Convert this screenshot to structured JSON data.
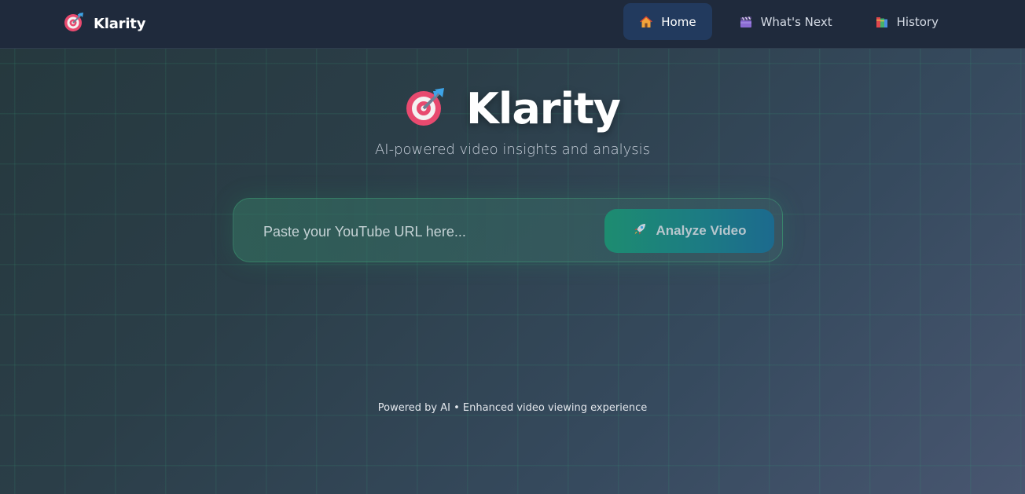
{
  "nav": {
    "brand": {
      "icon": "target-dart-icon",
      "name": "Klarity"
    },
    "links": [
      {
        "icon": "house-icon",
        "label": "Home",
        "active": true
      },
      {
        "icon": "clapperboard-icon",
        "label": "What's Next",
        "active": false
      },
      {
        "icon": "books-icon",
        "label": "History",
        "active": false
      }
    ]
  },
  "hero": {
    "icon": "target-dart-icon",
    "title": "Klarity",
    "subtitle": "AI-powered video insights and analysis"
  },
  "search": {
    "placeholder": "Paste your YouTube URL here...",
    "value": "",
    "button_icon": "rocket-icon",
    "button_label": "Analyze Video"
  },
  "footer": {
    "text": "Powered by AI • Enhanced video viewing experience"
  },
  "colors": {
    "nav_background": "#1f2a3c",
    "nav_active": "#223a5e",
    "accent_green": "#1d8c70",
    "accent_blue": "#1c6a8e"
  }
}
